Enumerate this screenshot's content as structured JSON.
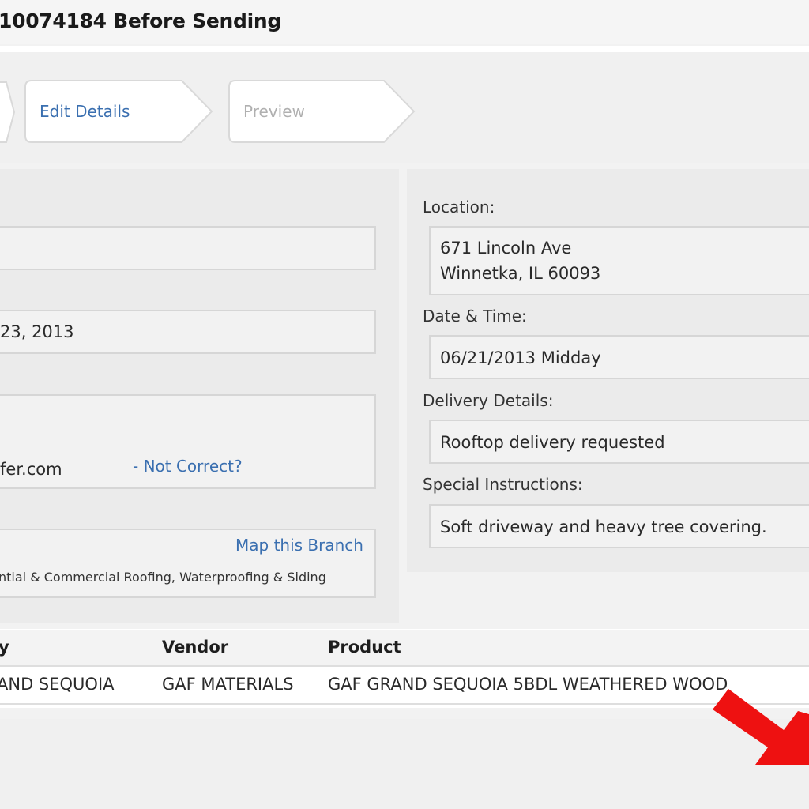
{
  "header": {
    "title": "10074184 Before Sending"
  },
  "steps": [
    {
      "label": "Edit Details",
      "state": "active"
    },
    {
      "label": "Preview",
      "state": "inactive"
    }
  ],
  "left_panel": {
    "date_value": "23, 2013",
    "email_value": "fer.com",
    "not_correct_link": "- Not Correct?",
    "map_branch_link": "Map this Branch",
    "branch_desc": "ntial & Commercial Roofing, Waterproofing & Siding"
  },
  "right_panel": {
    "location_label": "Location:",
    "location_line1": "671 Lincoln Ave",
    "location_line2": "Winnetka, IL 60093",
    "datetime_label": "Date & Time:",
    "datetime_value": "06/21/2013 Midday",
    "delivery_label": "Delivery Details:",
    "delivery_value": "Rooftop delivery requested",
    "instructions_label": "Special Instructions:",
    "instructions_value": "Soft driveway and heavy tree covering."
  },
  "table": {
    "headers": [
      "y",
      "Vendor",
      "Product"
    ],
    "rows": [
      [
        "AND SEQUOIA",
        "GAF MATERIALS",
        "GAF GRAND SEQUOIA 5BDL WEATHERED WOOD"
      ]
    ]
  },
  "colors": {
    "link": "#3a6fb0",
    "arrow": "#ee1111",
    "panel_bg": "#ebebeb"
  },
  "icons": {
    "annotation_arrow": "red-arrow-icon"
  }
}
